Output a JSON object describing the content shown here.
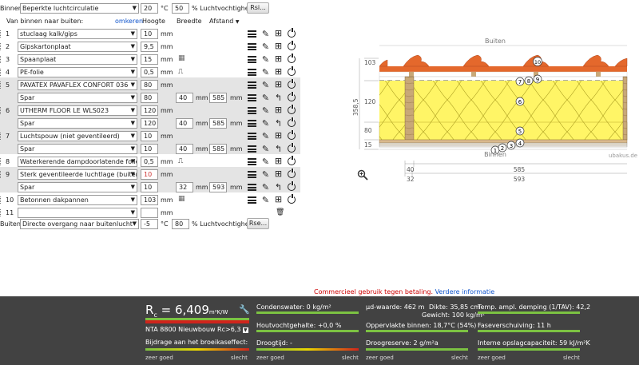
{
  "inside": {
    "label": "Binnen:",
    "select": "Beperkte luchtcirculatie",
    "temp": "20",
    "temp_unit": "°C",
    "rh": "50",
    "rh_unit": "% Luchtvochtigheid",
    "btn": "Rsi..."
  },
  "header": {
    "layers_label": "Van binnen naar buiten:",
    "reverse_link": "omkeren",
    "height": "Hoogte",
    "width": "Breedte",
    "distance": "Afstand"
  },
  "layers": [
    {
      "num": "1",
      "name": "stuclaag kalk/gips",
      "height": "10",
      "unit": "mm"
    },
    {
      "num": "2",
      "name": "Gipskartonplaat",
      "height": "9,5",
      "unit": "mm"
    },
    {
      "num": "3",
      "name": "Spaanplaat",
      "height": "15",
      "unit": "mm"
    },
    {
      "num": "4",
      "name": "PE-folie",
      "height": "0,5",
      "unit": "mm"
    },
    {
      "num": "5",
      "name": "PAVATEX PAVAFLEX CONFORT 036",
      "height": "80",
      "unit": "mm",
      "sub": {
        "name": "Spar",
        "height": "80",
        "width": "40",
        "distance": "585"
      }
    },
    {
      "num": "6",
      "name": "UTHERM FLOOR LE WLS023",
      "height": "120",
      "unit": "mm",
      "sub": {
        "name": "Spar",
        "height": "120",
        "width": "40",
        "distance": "585"
      }
    },
    {
      "num": "7",
      "name": "Luchtspouw (niet geventileerd)",
      "height": "10",
      "unit": "mm",
      "sub": {
        "name": "Spar",
        "height": "10",
        "width": "40",
        "distance": "585"
      }
    },
    {
      "num": "8",
      "name": "Waterkerende dampdoorlatende folie",
      "height": "0,5",
      "unit": "mm"
    },
    {
      "num": "9",
      "name": "Sterk geventileerde luchtlage (buiten",
      "height": "10",
      "unit": "mm",
      "sub": {
        "name": "Spar",
        "height": "10",
        "width": "32",
        "distance": "593"
      }
    },
    {
      "num": "10",
      "name": "Betonnen dakpannen",
      "height": "103",
      "unit": "mm"
    },
    {
      "num": "11",
      "name": "",
      "height": "",
      "unit": "mm"
    }
  ],
  "sub_unit": "mm",
  "outside": {
    "label": "Buiten:",
    "select": "Directe overgang naar buitenlucht",
    "temp": "-5",
    "temp_unit": "°C",
    "rh": "80",
    "rh_unit": "% Luchtvochtigheid",
    "btn": "Rse..."
  },
  "drawing": {
    "outside": "Buiten",
    "inside": "Binnen",
    "watermark": "ubakus.de",
    "dims_left": [
      "103",
      "120",
      "80",
      "15"
    ],
    "dim_total": "358,5",
    "dims_bottom_top": [
      "40",
      "585"
    ],
    "dims_bottom_bottom": [
      "32",
      "593"
    ],
    "markers": [
      "1",
      "2",
      "3",
      "4",
      "5",
      "6",
      "7",
      "8",
      "9",
      "10"
    ]
  },
  "notice": {
    "text": "Commercieel gebruik tegen betaling.",
    "link": "Verdere informatie"
  },
  "results": {
    "rc_label": "R",
    "rc_sub": "c",
    "rc_eq": " = ",
    "rc_value": "6,409",
    "rc_unit": "m²K/W",
    "standard": "NTA 8800 Nieuwbouw Rc>6,3",
    "greenhouse": "Bijdrage aan het broeikaseffect:",
    "condensate": "Condenswater: 0 kg/m²",
    "wood_moisture": "Houtvochtgehalte: +0,0 %",
    "drying_time": "Droogtijd: -",
    "sd_value": "µd-waarde: 462 m",
    "thickness": "Dikte: 35,85 cm",
    "weight": "Gewicht: 100 kg/m²",
    "surface_temp": "Oppervlakte binnen: 18,7°C (54%)",
    "drying_reserve": "Droogreserve: 2 g/m²a",
    "temp_damping": "Temp. ampl. demping (1/TAV): 42,2",
    "phase_shift": "Faseverschuiving: 11 h",
    "heat_capacity": "Interne opslagcapaciteit: 59 kJ/m²K",
    "scale_good": "zeer goed",
    "scale_bad": "slecht"
  },
  "colors": {
    "accent": "#1155cc",
    "notice": "#cc0000",
    "bar_green": "#7cc242",
    "bar_red": "#d0241c",
    "bar_yellow": "#e8d400"
  }
}
